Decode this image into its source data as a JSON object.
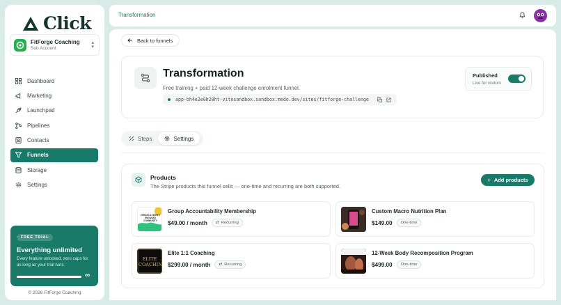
{
  "app": {
    "name": "Click"
  },
  "account": {
    "name": "FitForge Coaching",
    "type": "Sub Account"
  },
  "nav": [
    {
      "label": "Dashboard",
      "icon": "grid-icon",
      "active": false
    },
    {
      "label": "Marketing",
      "icon": "megaphone-icon",
      "active": false
    },
    {
      "label": "Launchpad",
      "icon": "rocket-icon",
      "active": false
    },
    {
      "label": "Pipelines",
      "icon": "pipeline-icon",
      "active": false
    },
    {
      "label": "Contacts",
      "icon": "contacts-icon",
      "active": false
    },
    {
      "label": "Funnels",
      "icon": "funnel-icon",
      "active": true
    },
    {
      "label": "Storage",
      "icon": "database-icon",
      "active": false
    },
    {
      "label": "Settings",
      "icon": "gear-icon",
      "active": false
    }
  ],
  "trial": {
    "badge": "FREE TRIAL",
    "title": "Everything unlimited",
    "description": "Every feature unlocked, zero caps for as long as your trial runs.",
    "infinity": "∞"
  },
  "footer": {
    "copyright": "© 2026 FitForge Coaching"
  },
  "topbar": {
    "breadcrumb": "Transformation"
  },
  "back_label": "Back to funnels",
  "funnel": {
    "title": "Transformation",
    "description": "Free training + paid 12-week challenge enrolment funnel.",
    "url": "app-bh4e2e0h20ht-vitesandbox.sandbox.medo.dev/sites/fitforge-challenge",
    "published_label": "Published",
    "published_sub": "Live for visitors",
    "published": true
  },
  "tabs": [
    {
      "label": "Steps",
      "active": false
    },
    {
      "label": "Settings",
      "active": true
    }
  ],
  "products_section": {
    "title": "Products",
    "subtitle": "The Stripe products this funnel sells — one-time and recurring are both supported.",
    "add_label": "Add products"
  },
  "products": [
    {
      "name": "Group Accountability Membership",
      "price": "$49.00 / month",
      "billing": "Recurring",
      "thumb_text": "CREATE A HIGHLY ENGAGED COMMUNITY"
    },
    {
      "name": "Custom Macro Nutrition Plan",
      "price": "$149.00",
      "billing": "One-time",
      "thumb_text": ""
    },
    {
      "name": "Elite 1:1 Coaching",
      "price": "$299.00 / month",
      "billing": "Recurring",
      "thumb_text": "ELITE COACHING"
    },
    {
      "name": "12-Week Body Recomposition Program",
      "price": "$499.00",
      "billing": "One-time",
      "thumb_text": ""
    }
  ],
  "colors": {
    "brand": "#187a68",
    "background": "#d9ebe6",
    "avatar": "#8b2fa8"
  }
}
